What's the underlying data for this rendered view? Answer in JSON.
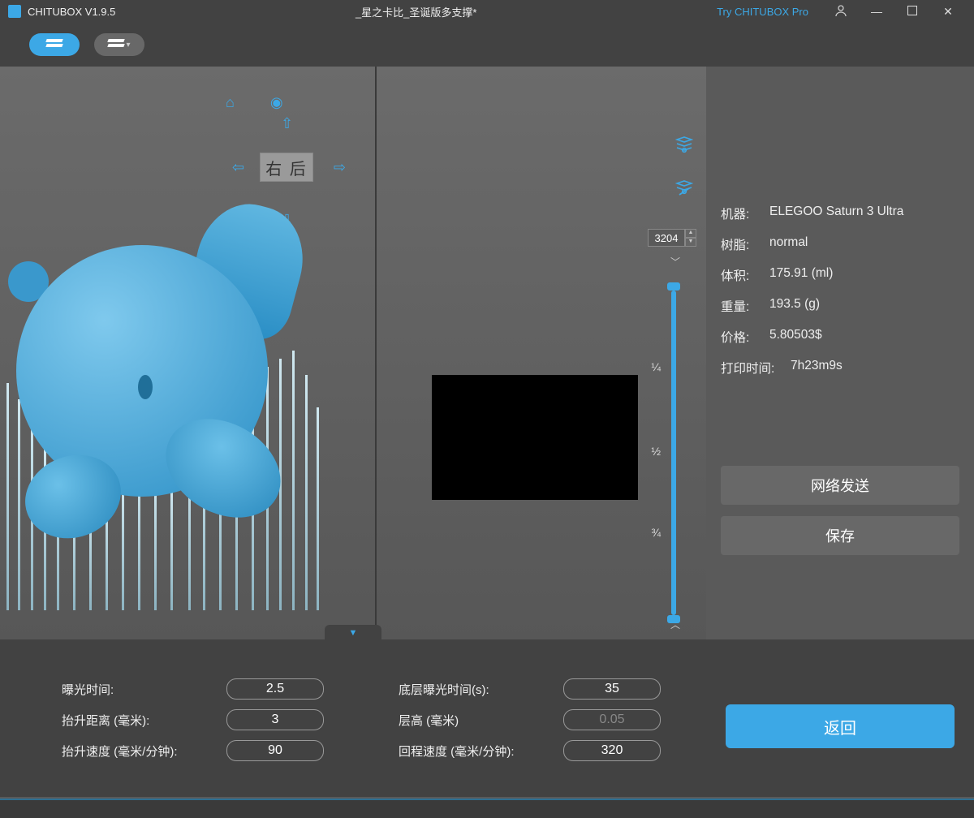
{
  "titlebar": {
    "app": "CHITUBOX V1.9.5",
    "document": "_星之卡比_圣诞版多支撑*",
    "pro": "Try CHITUBOX Pro"
  },
  "viewport": {
    "view_label": "右 后",
    "layer_count": "3204"
  },
  "slider": {
    "q1": "¼",
    "q2": "½",
    "q3": "¾"
  },
  "info": {
    "machine_label": "机器:",
    "machine": "ELEGOO Saturn 3 Ultra",
    "resin_label": "树脂:",
    "resin": "normal",
    "volume_label": "体积:",
    "volume": "175.91  (ml)",
    "weight_label": "重量:",
    "weight": "193.5  (g)",
    "price_label": "价格:",
    "price": "5.80503$",
    "time_label": "打印时间:",
    "time": "7h23m9s",
    "send": "网络发送",
    "save": "保存"
  },
  "params": {
    "exposure_label": "曝光时间:",
    "exposure": "2.5",
    "lift_dist_label": "抬升距离 (毫米):",
    "lift_dist": "3",
    "lift_speed_label": "抬升速度 (毫米/分钟):",
    "lift_speed": "90",
    "bottom_exposure_label": "底层曝光时间(s):",
    "bottom_exposure": "35",
    "layer_height_label": "层高 (毫米)",
    "layer_height": "0.05",
    "retract_speed_label": "回程速度 (毫米/分钟):",
    "retract_speed": "320"
  },
  "return_label": "返回"
}
